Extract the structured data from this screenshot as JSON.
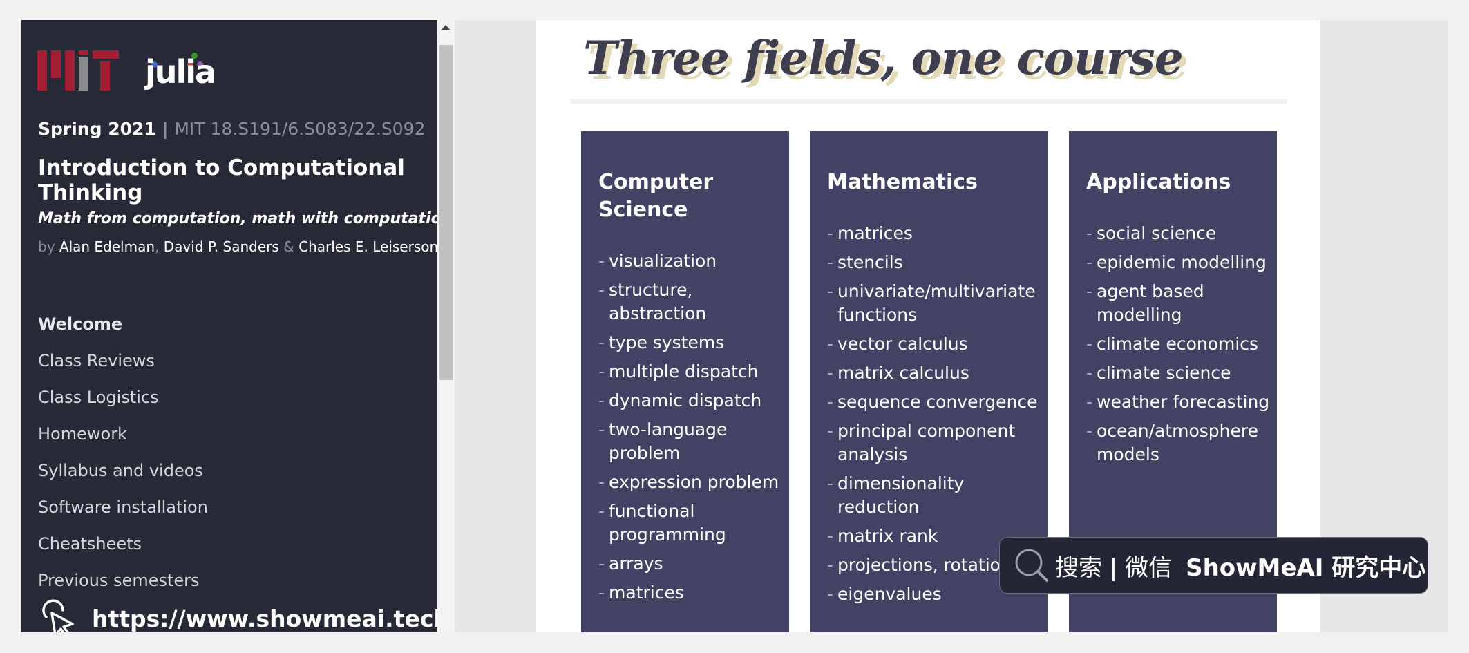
{
  "sidebar": {
    "logo_mit": "MIT",
    "logo_julia": "julia",
    "semester": "Spring 2021",
    "separator": "|",
    "course_codes": "MIT 18.S191/6.S083/22.S092",
    "title": "Introduction to Computational Thinking",
    "tagline": "Math from computation, math with computation",
    "by_label": "by",
    "authors": [
      "Alan Edelman",
      "David P. Sanders",
      "Charles E. Leiserson"
    ],
    "amp": "&",
    "nav": [
      {
        "label": "Welcome",
        "active": true
      },
      {
        "label": "Class Reviews",
        "active": false
      },
      {
        "label": "Class Logistics",
        "active": false
      },
      {
        "label": "Homework",
        "active": false
      },
      {
        "label": "Syllabus and videos",
        "active": false
      },
      {
        "label": "Software installation",
        "active": false
      },
      {
        "label": "Cheatsheets",
        "active": false
      },
      {
        "label": "Previous semesters",
        "active": false
      }
    ],
    "site_url": "https://www.showmeai.tech"
  },
  "main": {
    "title": "Three fields, one course",
    "cards": [
      {
        "heading": "Computer Science",
        "items": [
          "visualization",
          "structure, abstraction",
          "type systems",
          "multiple dispatch",
          "dynamic dispatch",
          "two-language problem",
          "expression problem",
          "functional programming",
          "arrays",
          "matrices"
        ]
      },
      {
        "heading": "Mathematics",
        "items": [
          "matrices",
          "stencils",
          "univariate/multivariate functions",
          "vector calculus",
          "matrix calculus",
          "sequence convergence",
          "principal component analysis",
          "dimensionality reduction",
          "matrix rank",
          "projections, rotation",
          "eigenvalues"
        ]
      },
      {
        "heading": "Applications",
        "items": [
          "social science",
          "epidemic modelling",
          "agent based modelling",
          "climate economics",
          "climate science",
          "weather forecasting",
          "ocean/atmosphere models"
        ]
      }
    ]
  },
  "watermark": {
    "search_text": "搜索 | 微信",
    "brand": "ShowMeAI 研究中心"
  },
  "colors": {
    "sidebar_bg": "#282936",
    "card_bg": "#424265",
    "title_text": "#3e3e4e",
    "title_shadow": "#e3d9b6",
    "mit_red": "#a31f34",
    "mit_gray": "#8a8b8c"
  }
}
